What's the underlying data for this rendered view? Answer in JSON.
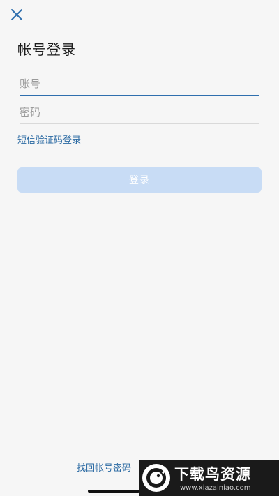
{
  "header": {
    "close_icon": "close-icon",
    "title": "帐号登录"
  },
  "form": {
    "account_placeholder": "账号",
    "password_placeholder": "密码",
    "sms_login_label": "短信验证码登录",
    "login_button_label": "登录"
  },
  "footer": {
    "recover_label": "找回帐号密码"
  },
  "watermark": {
    "title": "下载鸟资源",
    "url": "www.xiazainiao.com"
  },
  "colors": {
    "accent": "#2b6aa3",
    "button_disabled": "#c8dcf5",
    "background": "#f6f6f6"
  }
}
